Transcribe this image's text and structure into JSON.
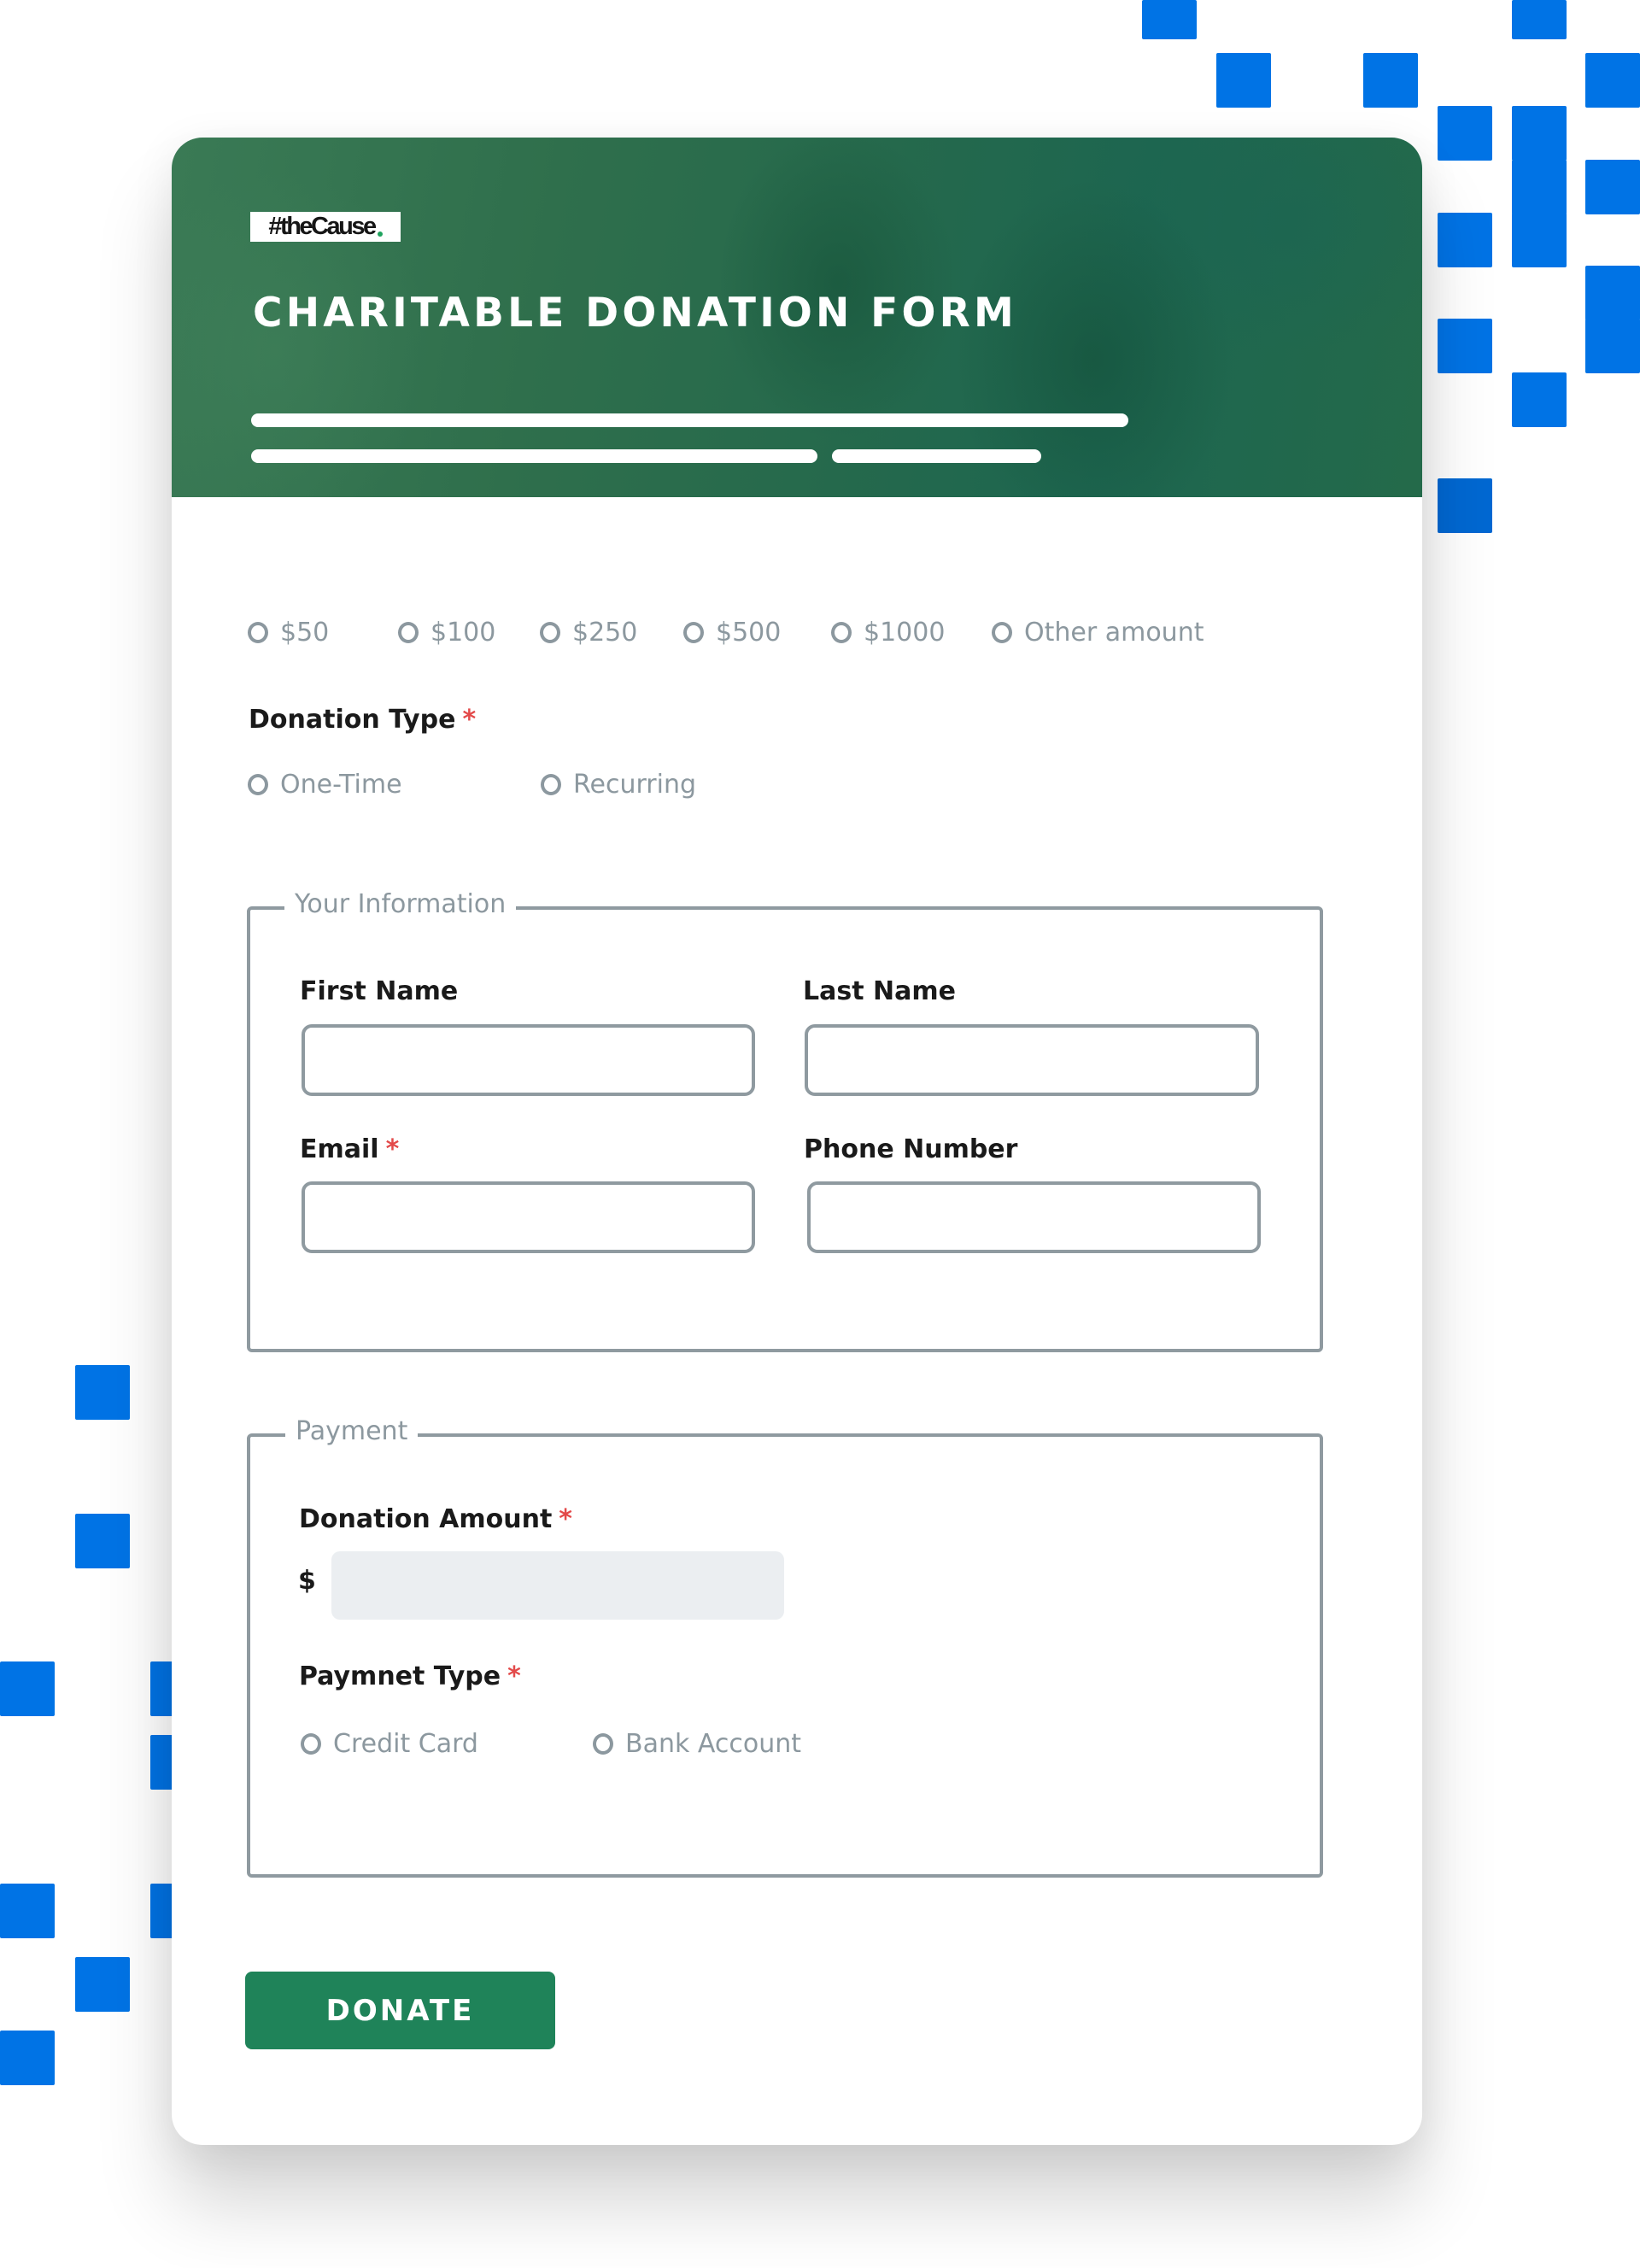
{
  "brand": {
    "logo_text": "#theCause",
    "accent_color": "#1f8359",
    "decor_color": "#0073e5"
  },
  "header": {
    "title": "CHARITABLE DONATION FORM"
  },
  "amount_options": [
    {
      "label": "$50",
      "selected": false
    },
    {
      "label": "$100",
      "selected": false
    },
    {
      "label": "$250",
      "selected": false
    },
    {
      "label": "$500",
      "selected": false
    },
    {
      "label": "$1000",
      "selected": false
    },
    {
      "label": "Other amount",
      "selected": false
    }
  ],
  "donation_type": {
    "label": "Donation Type",
    "required_mark": "*",
    "options": [
      {
        "label": "One-Time",
        "selected": false
      },
      {
        "label": "Recurring",
        "selected": false
      }
    ]
  },
  "your_information": {
    "legend": "Your Information",
    "first_name": {
      "label": "First Name",
      "value": "",
      "placeholder": ""
    },
    "last_name": {
      "label": "Last Name",
      "value": "",
      "placeholder": ""
    },
    "email": {
      "label": "Email",
      "required_mark": "*",
      "value": "",
      "placeholder": ""
    },
    "phone": {
      "label": "Phone Number",
      "value": "",
      "placeholder": ""
    }
  },
  "payment": {
    "legend": "Payment",
    "donation_amount": {
      "label": "Donation Amount",
      "required_mark": "*",
      "currency_symbol": "$",
      "value": "",
      "placeholder": ""
    },
    "payment_type": {
      "label": "Paymnet Type",
      "required_mark": "*",
      "options": [
        {
          "label": "Credit Card",
          "selected": false
        },
        {
          "label": "Bank Account",
          "selected": false
        }
      ]
    }
  },
  "actions": {
    "donate_label": "DONATE"
  }
}
